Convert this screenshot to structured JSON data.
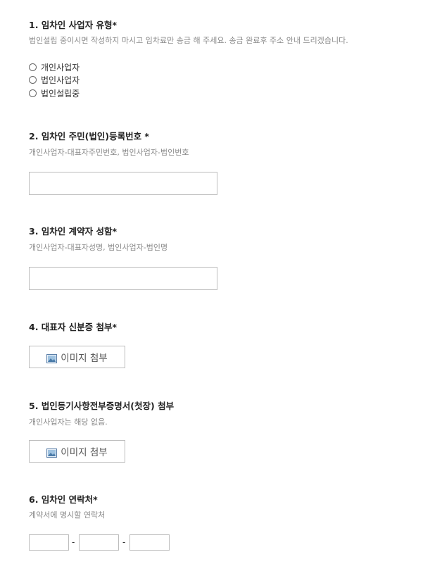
{
  "q1": {
    "title": "1. 임차인 사업자 유형*",
    "desc": "법인설립 중이시면 작성하지 마시고 임차료만 송금 해 주세요. 송금 완료후 주소 안내 드리겠습니다.",
    "options": [
      "개인사업자",
      "법인사업자",
      "법인설립중"
    ]
  },
  "q2": {
    "title": "2. 임차인 주민(법인)등록번호 *",
    "desc": "개인사업자-대표자주민번호, 법인사업자-법인번호",
    "value": ""
  },
  "q3": {
    "title": "3. 임차인 계약자 성함*",
    "desc": "개인사업자-대표자성명, 법인사업자-법인명",
    "value": ""
  },
  "q4": {
    "title": "4. 대표자 신분증 첨부*",
    "button_label": "이미지 첨부",
    "button_icon": "image-icon"
  },
  "q5": {
    "title": "5. 법인등기사항전부증명서(첫장) 첨부",
    "desc": "개인사업자는 해당 없음.",
    "button_label": "이미지 첨부",
    "button_icon": "image-icon"
  },
  "q6": {
    "title": "6. 임차인 연락처*",
    "desc": "계약서에 명시할 연락처",
    "phone_parts": [
      "",
      "",
      ""
    ],
    "separator": "-"
  }
}
